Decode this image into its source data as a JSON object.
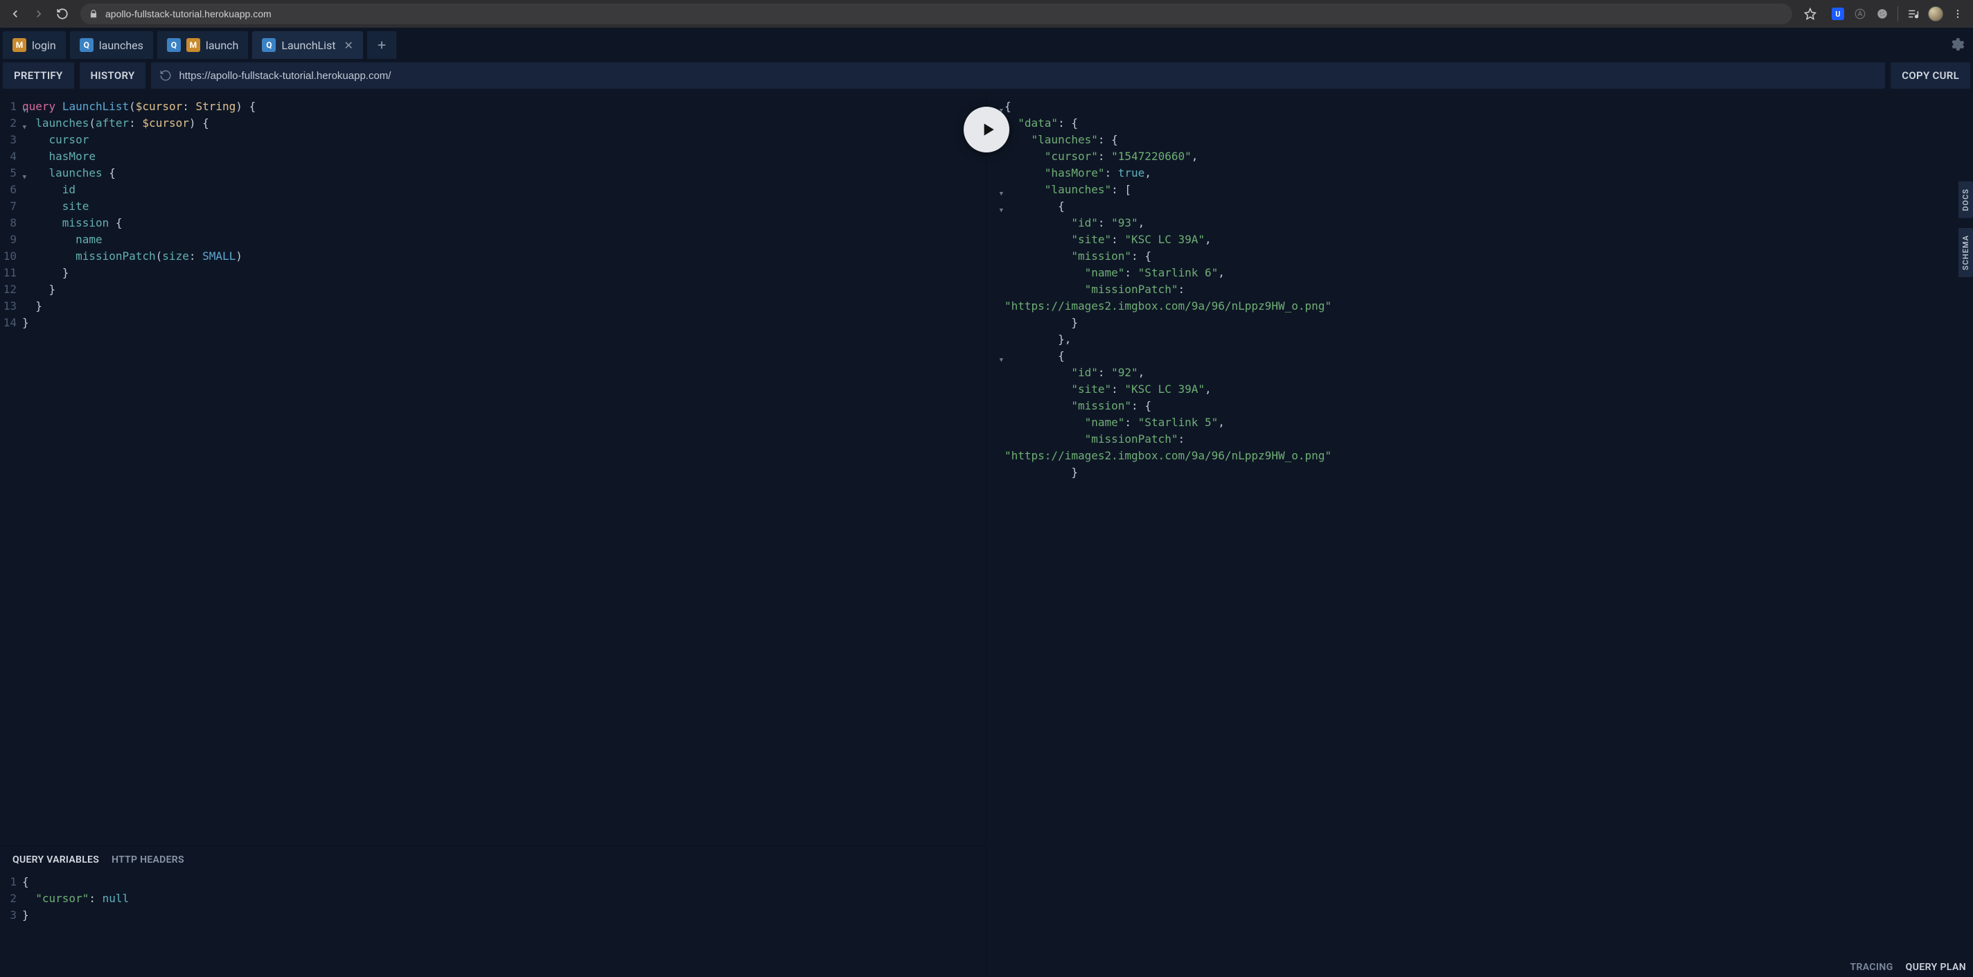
{
  "browser": {
    "url": "apollo-fullstack-tutorial.herokuapp.com"
  },
  "tabs": [
    {
      "badges": [
        "M"
      ],
      "label": "login",
      "active": false,
      "closeable": false
    },
    {
      "badges": [
        "Q"
      ],
      "label": "launches",
      "active": false,
      "closeable": false
    },
    {
      "badges": [
        "Q",
        "M"
      ],
      "label": "launch",
      "active": false,
      "closeable": false
    },
    {
      "badges": [
        "Q"
      ],
      "label": "LaunchList",
      "active": true,
      "closeable": true
    }
  ],
  "toolbar": {
    "prettify": "PRETTIFY",
    "history": "HISTORY",
    "url": "https://apollo-fullstack-tutorial.herokuapp.com/",
    "copy_curl": "COPY CURL"
  },
  "query": {
    "lines": [
      {
        "n": 1,
        "fold": true,
        "html": "<span class='tok-kw'>query</span> <span class='tok-def'>LaunchList</span><span class='tok-brace'>(</span><span class='tok-var'>$cursor</span><span class='tok-brace'>:</span> <span class='tok-type'>String</span><span class='tok-brace'>)</span> <span class='tok-brace'>{</span>"
      },
      {
        "n": 2,
        "fold": true,
        "html": "  <span class='tok-attr'>launches</span><span class='tok-brace'>(</span><span class='tok-attr'>after</span><span class='tok-brace'>:</span> <span class='tok-var'>$cursor</span><span class='tok-brace'>)</span> <span class='tok-brace'>{</span>"
      },
      {
        "n": 3,
        "html": "    <span class='tok-attr'>cursor</span>"
      },
      {
        "n": 4,
        "html": "    <span class='tok-attr'>hasMore</span>"
      },
      {
        "n": 5,
        "fold": true,
        "html": "    <span class='tok-attr'>launches</span> <span class='tok-brace'>{</span>"
      },
      {
        "n": 6,
        "html": "      <span class='tok-attr'>id</span>"
      },
      {
        "n": 7,
        "html": "      <span class='tok-attr'>site</span>"
      },
      {
        "n": 8,
        "html": "      <span class='tok-attr'>mission</span> <span class='tok-brace'>{</span>"
      },
      {
        "n": 9,
        "html": "        <span class='tok-attr'>name</span>"
      },
      {
        "n": 10,
        "html": "        <span class='tok-attr'>missionPatch</span><span class='tok-brace'>(</span><span class='tok-attr'>size</span><span class='tok-brace'>:</span> <span class='tok-enum'>SMALL</span><span class='tok-brace'>)</span>"
      },
      {
        "n": 11,
        "html": "      <span class='tok-brace'>}</span>"
      },
      {
        "n": 12,
        "html": "    <span class='tok-brace'>}</span>"
      },
      {
        "n": 13,
        "html": "  <span class='tok-brace'>}</span>"
      },
      {
        "n": 14,
        "html": "<span class='tok-brace'>}</span>"
      }
    ]
  },
  "vars_tabs": {
    "qv": "QUERY VARIABLES",
    "hh": "HTTP HEADERS"
  },
  "vars": {
    "lines": [
      {
        "n": 1,
        "html": "<span class='tok-brace'>{</span>"
      },
      {
        "n": 2,
        "html": "  <span class='tok-key'>\"cursor\"</span><span class='tok-punc'>:</span> <span class='tok-null'>null</span>"
      },
      {
        "n": 3,
        "html": "<span class='tok-brace'>}</span>"
      }
    ]
  },
  "result": {
    "lines": [
      {
        "fold": true,
        "indent": 0,
        "html": "<span class='tok-brace'>{</span>"
      },
      {
        "fold": true,
        "indent": 1,
        "html": "<span class='tok-key'>\"data\"</span><span class='tok-punc'>:</span> <span class='tok-brace'>{</span>"
      },
      {
        "fold": true,
        "indent": 2,
        "html": "<span class='tok-key'>\"launches\"</span><span class='tok-punc'>:</span> <span class='tok-brace'>{</span>"
      },
      {
        "indent": 3,
        "html": "<span class='tok-key'>\"cursor\"</span><span class='tok-punc'>:</span> <span class='tok-str'>\"1547220660\"</span><span class='tok-punc'>,</span>"
      },
      {
        "indent": 3,
        "html": "<span class='tok-key'>\"hasMore\"</span><span class='tok-punc'>:</span> <span class='tok-bool'>true</span><span class='tok-punc'>,</span>"
      },
      {
        "fold": true,
        "indent": 3,
        "html": "<span class='tok-key'>\"launches\"</span><span class='tok-punc'>:</span> <span class='tok-brace'>[</span>"
      },
      {
        "fold": true,
        "indent": 4,
        "html": "<span class='tok-brace'>{</span>"
      },
      {
        "indent": 5,
        "html": "<span class='tok-key'>\"id\"</span><span class='tok-punc'>:</span> <span class='tok-str'>\"93\"</span><span class='tok-punc'>,</span>"
      },
      {
        "indent": 5,
        "html": "<span class='tok-key'>\"site\"</span><span class='tok-punc'>:</span> <span class='tok-str'>\"KSC LC 39A\"</span><span class='tok-punc'>,</span>"
      },
      {
        "indent": 5,
        "html": "<span class='tok-key'>\"mission\"</span><span class='tok-punc'>:</span> <span class='tok-brace'>{</span>"
      },
      {
        "indent": 6,
        "html": "<span class='tok-key'>\"name\"</span><span class='tok-punc'>:</span> <span class='tok-str'>\"Starlink 6\"</span><span class='tok-punc'>,</span>"
      },
      {
        "indent": 6,
        "html": "<span class='tok-key'>\"missionPatch\"</span><span class='tok-punc'>:</span>"
      },
      {
        "indent": 0,
        "html": "<span class='tok-str'>\"https://images2.imgbox.com/9a/96/nLppz9HW_o.png\"</span>"
      },
      {
        "indent": 5,
        "html": "<span class='tok-brace'>}</span>"
      },
      {
        "indent": 4,
        "html": "<span class='tok-brace'>}</span><span class='tok-punc'>,</span>"
      },
      {
        "fold": true,
        "indent": 4,
        "html": "<span class='tok-brace'>{</span>"
      },
      {
        "indent": 5,
        "html": "<span class='tok-key'>\"id\"</span><span class='tok-punc'>:</span> <span class='tok-str'>\"92\"</span><span class='tok-punc'>,</span>"
      },
      {
        "indent": 5,
        "html": "<span class='tok-key'>\"site\"</span><span class='tok-punc'>:</span> <span class='tok-str'>\"KSC LC 39A\"</span><span class='tok-punc'>,</span>"
      },
      {
        "indent": 5,
        "html": "<span class='tok-key'>\"mission\"</span><span class='tok-punc'>:</span> <span class='tok-brace'>{</span>"
      },
      {
        "indent": 6,
        "html": "<span class='tok-key'>\"name\"</span><span class='tok-punc'>:</span> <span class='tok-str'>\"Starlink 5\"</span><span class='tok-punc'>,</span>"
      },
      {
        "indent": 6,
        "html": "<span class='tok-key'>\"missionPatch\"</span><span class='tok-punc'>:</span>"
      },
      {
        "indent": 0,
        "html": "<span class='tok-str'>\"https://images2.imgbox.com/9a/96/nLppz9HW_o.png\"</span>"
      },
      {
        "indent": 5,
        "html": "<span class='tok-brace'>}</span>"
      }
    ]
  },
  "rails": {
    "docs": "DOCS",
    "schema": "SCHEMA"
  },
  "footer": {
    "tracing": "TRACING",
    "query_plan": "QUERY PLAN"
  }
}
